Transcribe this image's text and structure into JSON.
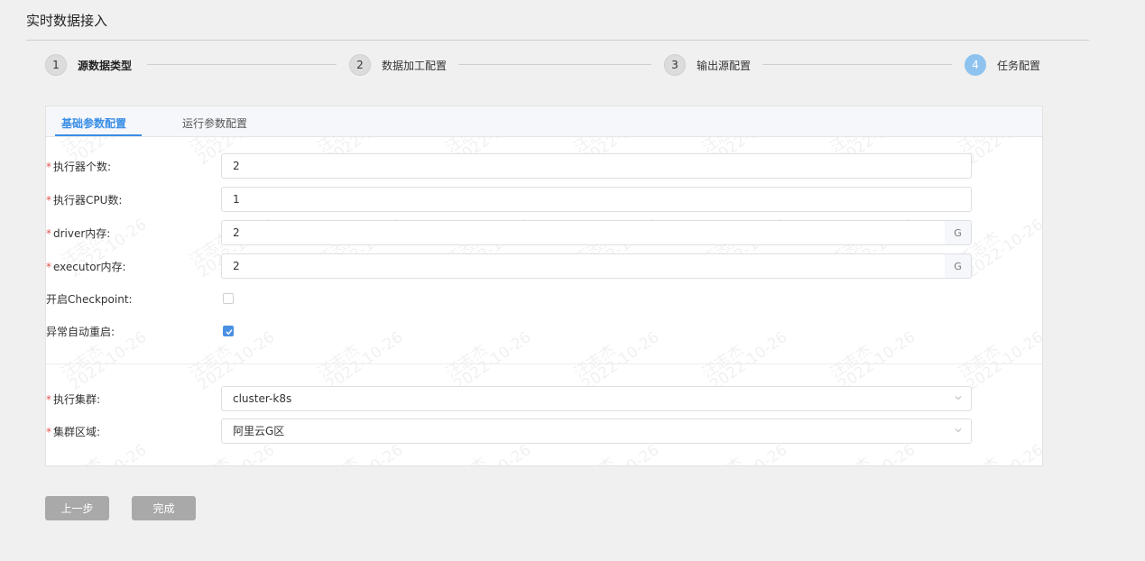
{
  "page": {
    "title": "实时数据接入"
  },
  "steps": [
    {
      "num": "1",
      "label": "源数据类型"
    },
    {
      "num": "2",
      "label": "数据加工配置"
    },
    {
      "num": "3",
      "label": "输出源配置"
    },
    {
      "num": "4",
      "label": "任务配置"
    }
  ],
  "tabs": {
    "basic": "基础参数配置",
    "runtime": "运行参数配置"
  },
  "required_mark": "*",
  "form": {
    "executor_count": {
      "label": "执行器个数:",
      "value": "2"
    },
    "executor_cpu": {
      "label": "执行器CPU数:",
      "value": "1"
    },
    "driver_memory": {
      "label": "driver内存:",
      "value": "2",
      "unit": "G"
    },
    "executor_memory": {
      "label": "executor内存:",
      "value": "2",
      "unit": "G"
    },
    "checkpoint": {
      "label": "开启Checkpoint:",
      "checked": false
    },
    "auto_restart": {
      "label": "异常自动重启:",
      "checked": true
    },
    "cluster": {
      "label": "执行集群:",
      "value": "cluster-k8s"
    },
    "region": {
      "label": "集群区域:",
      "value": "阿里云G区"
    }
  },
  "watermark": {
    "name": "汪志杰",
    "date": "2022-10-26"
  },
  "buttons": {
    "prev": "上一步",
    "finish": "完成"
  },
  "colors": {
    "accent": "#3a8ee6",
    "required": "#e35353",
    "step_active": "#8ec3f0",
    "button": "#a9a9a9"
  }
}
